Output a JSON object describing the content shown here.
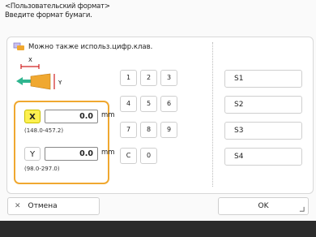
{
  "header": {
    "line1": "<Пользовательский формат>",
    "line2": "Введите формат бумаги."
  },
  "hint": {
    "icon": "paper-hand-icon",
    "text": "Можно также использ.цифр.клав."
  },
  "diagram": {
    "label_x": "X",
    "label_y": "Y"
  },
  "fields": {
    "x": {
      "axis": "X",
      "value": "0.0",
      "unit": "mm",
      "range": "(148.0-457.2)"
    },
    "y": {
      "axis": "Y",
      "value": "0.0",
      "unit": "mm",
      "range": "(98.0-297.0)"
    }
  },
  "keypad": {
    "k1": "1",
    "k2": "2",
    "k3": "3",
    "k4": "4",
    "k5": "5",
    "k6": "6",
    "k7": "7",
    "k8": "8",
    "k9": "9",
    "kc": "C",
    "k0": "0"
  },
  "presets": [
    "S1",
    "S2",
    "S3",
    "S4"
  ],
  "buttons": {
    "cancel": "Отмена",
    "ok": "OK"
  },
  "colors": {
    "accent_border": "#f0a830",
    "active_axis": "#fdf050",
    "arrow_green": "#2fb58f",
    "paper_orange": "#f0a830",
    "dimension_red": "#d02020"
  }
}
